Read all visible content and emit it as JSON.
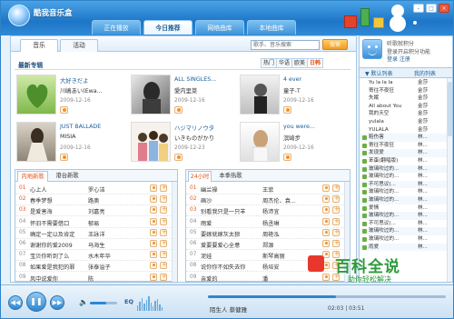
{
  "app": {
    "title": "酷我音乐盒"
  },
  "top_tabs": [
    {
      "label": "正在播放"
    },
    {
      "label": "今日推荐"
    },
    {
      "label": "网络曲库"
    },
    {
      "label": "本地曲库"
    }
  ],
  "sub_tabs": [
    {
      "label": "音乐"
    },
    {
      "label": "活动"
    }
  ],
  "search": {
    "placeholder": "歌手、音乐搜索",
    "button": "搜索"
  },
  "albums": {
    "heading": "最新专辑",
    "filters": [
      "热门",
      "华语",
      "欧美",
      "日韩"
    ],
    "items": [
      {
        "title": "大好きだよ",
        "artist": "川嶋あい(Ewa...",
        "date": "2009-12-16"
      },
      {
        "title": "ALL SINGLES...",
        "artist": "愛内里菜",
        "date": "2009-12-16"
      },
      {
        "title": "4 ever",
        "artist": "童子-T",
        "date": "2009-12-16"
      },
      {
        "title": "JUST BALLADE",
        "artist": "MISIA",
        "date": "2009-12-16"
      },
      {
        "title": "ハジマリノウタ",
        "artist": "いきものがかり",
        "date": "2009-12-23"
      },
      {
        "title": "you were...",
        "artist": "滨崎步",
        "date": "2009-12-16"
      }
    ]
  },
  "left_list": {
    "tabs": [
      "内地新歌",
      "港台新歌"
    ],
    "rows": [
      {
        "num": "01",
        "song": "心上人",
        "artist": "罗心洁"
      },
      {
        "num": "02",
        "song": "春季梦想",
        "artist": "路奥"
      },
      {
        "num": "03",
        "song": "是爱害海",
        "artist": "刘嘉亮"
      },
      {
        "num": "04",
        "song": "怀旧不需要借口",
        "artist": "郁易"
      },
      {
        "num": "05",
        "song": "确定一定以及肯定",
        "artist": "王詠洋"
      },
      {
        "num": "06",
        "song": "谢谢你的爱2009",
        "artist": "马海生"
      },
      {
        "num": "07",
        "song": "宝贝你听到了么",
        "artist": "水木年华"
      },
      {
        "num": "08",
        "song": "如果爱是我犯的罪",
        "artist": "张泰溢子"
      },
      {
        "num": "09",
        "song": "风中说爱你",
        "artist": "陈"
      }
    ]
  },
  "right_list": {
    "tabs": [
      "24小时",
      "本季热歌"
    ],
    "rows": [
      {
        "num": "01",
        "song": "幽兰操",
        "artist": "王菲"
      },
      {
        "num": "02",
        "song": "画沙",
        "artist": "周杰伦、袁..."
      },
      {
        "num": "03",
        "song": "别看我只是一只羊",
        "artist": "杨沛宜"
      },
      {
        "num": "04",
        "song": "雨爱",
        "artist": "杨丞琳"
      },
      {
        "num": "05",
        "song": "要嫁就嫁灰太狼",
        "artist": "周艳泓"
      },
      {
        "num": "06",
        "song": "爱要要爱心全意",
        "artist": "郑源"
      },
      {
        "num": "07",
        "song": "泥娃",
        "artist": "斯琴高丽"
      },
      {
        "num": "08",
        "song": "说你你不如失去你",
        "artist": "杨培安"
      },
      {
        "num": "09",
        "song": "亲爱的",
        "artist": "潘"
      }
    ]
  },
  "side": {
    "line1": "听歌就积分",
    "line2": "登录开启积分功能",
    "login": "登录  注册",
    "tabs": [
      "默认列表",
      "我的列表"
    ],
    "playlist": [
      {
        "song": "Yu la la la",
        "artist": "金莎"
      },
      {
        "song": "寄往不夜狂",
        "artist": "金莎"
      },
      {
        "song": "失眠",
        "artist": "金莎"
      },
      {
        "song": "All about You",
        "artist": "金莎"
      },
      {
        "song": "我的天空",
        "artist": "金莎"
      },
      {
        "song": "yulala",
        "artist": "金莎"
      },
      {
        "song": "YULALA",
        "artist": "金莎"
      },
      {
        "song": "鞋伤害",
        "artist": "林..."
      },
      {
        "song": "寄往不夜狂",
        "artist": "林..."
      },
      {
        "song": "发现爱",
        "artist": "林..."
      },
      {
        "song": "苯蛋(翻唱版)",
        "artist": "林..."
      },
      {
        "song": "玻璃吹过的...",
        "artist": "林..."
      },
      {
        "song": "玻璃吹过的...",
        "artist": "林..."
      },
      {
        "song": "不可思议(...",
        "artist": "林..."
      },
      {
        "song": "玻璃吹过的...",
        "artist": "林..."
      },
      {
        "song": "玻璃吹过的...",
        "artist": "林..."
      },
      {
        "song": "爱情",
        "artist": "林..."
      },
      {
        "song": "玻璃吹过的...",
        "artist": "林..."
      },
      {
        "song": "不可思议(...",
        "artist": "林..."
      },
      {
        "song": "玻璃吹过的...",
        "artist": "林..."
      },
      {
        "song": "玻璃吹过的...",
        "artist": "林..."
      },
      {
        "song": "雨爱",
        "artist": "林..."
      }
    ]
  },
  "player": {
    "now_playing": "陌生人  蔡健雅",
    "time": "02:03  |  03:51",
    "eq": "EQ",
    "progress": 0.54,
    "volume": 0.6,
    "icons": [
      "prev-icon",
      "play-pause-icon",
      "next-icon",
      "volume-icon"
    ]
  },
  "watermark": {
    "main": "百科全说",
    "sub": "助你轻松解决"
  }
}
